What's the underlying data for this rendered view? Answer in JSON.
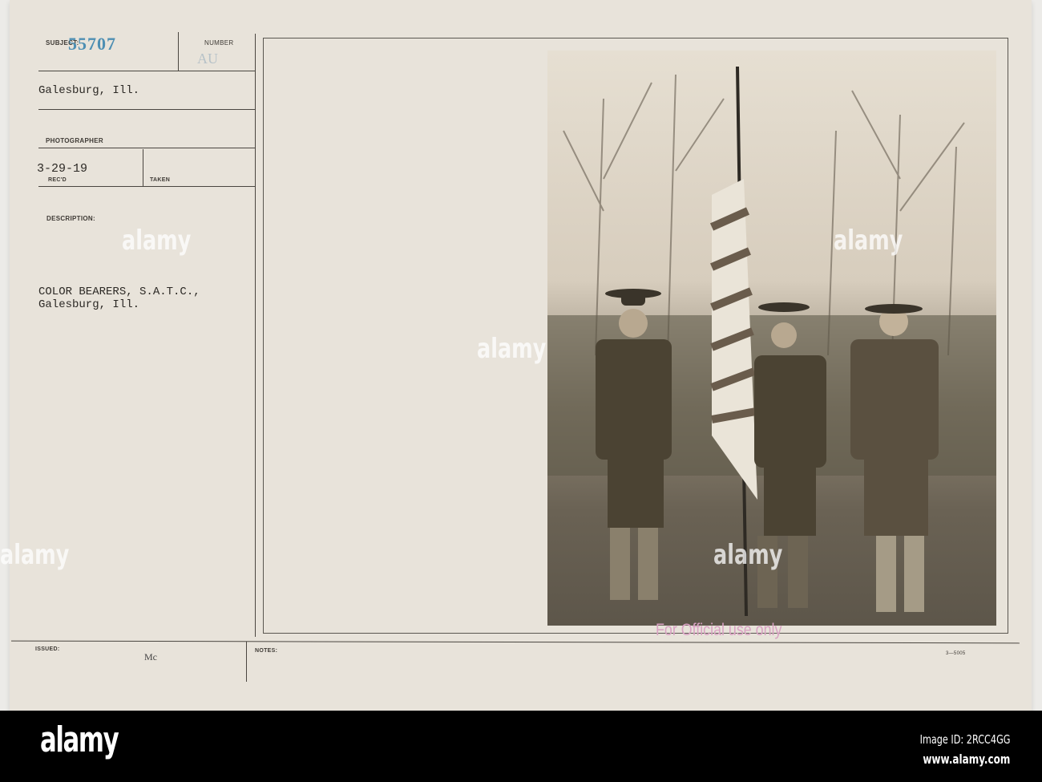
{
  "card": {
    "subject_label": "SUBJECT:",
    "subject_number": "55707",
    "number_label": "NUMBER",
    "number_value": "AU",
    "location": "Galesburg, Ill.",
    "photographer_label": "PHOTOGRAPHER",
    "recd_date": "3-29-19",
    "recd_label": "REC'D",
    "taken_label": "TAKEN",
    "description_label": "DESCRIPTION:",
    "description_line1": "COLOR BEARERS, S.A.T.C.,",
    "description_line2": "Galesburg, Ill.",
    "issued_label": "ISSUED:",
    "issued_initials": "Mc",
    "notes_label": "NOTES:",
    "form_number": "3—5005",
    "stamp": "For Official use only"
  },
  "watermark": "alamy",
  "footer": {
    "logo": "alamy",
    "image_id": "Image ID: 2RCC4GG",
    "url": "www.alamy.com"
  }
}
